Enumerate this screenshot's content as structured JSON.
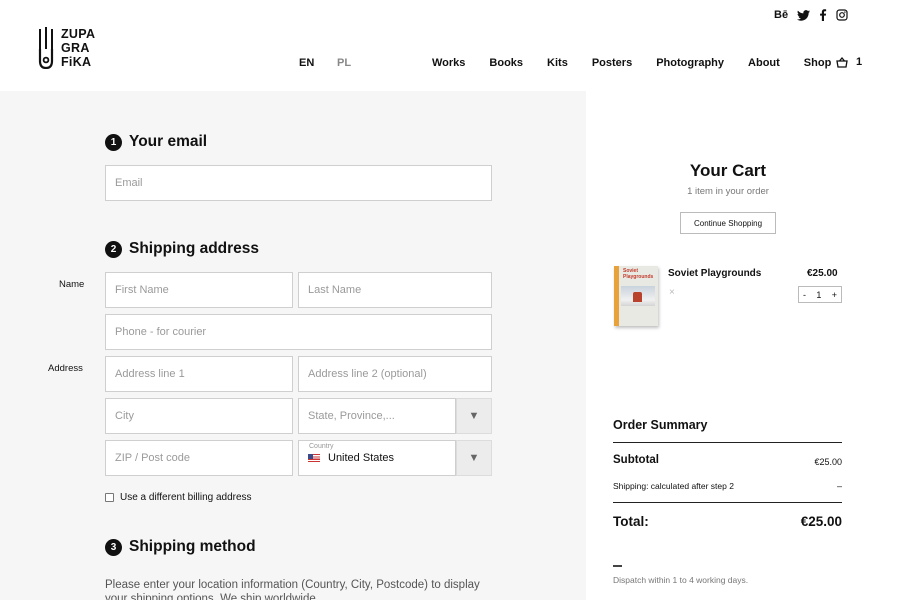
{
  "brand": {
    "line1": "ZUPA",
    "line2": "GRA",
    "line3": "FiKA"
  },
  "languages": {
    "en": "EN",
    "pl": "PL"
  },
  "nav": [
    "Works",
    "Books",
    "Kits",
    "Posters",
    "Photography",
    "About",
    "Shop"
  ],
  "cart_count": "1",
  "social": {
    "behance": "Bē",
    "icons": [
      "twitter-icon",
      "facebook-icon",
      "instagram-icon"
    ]
  },
  "steps": [
    {
      "num": "1",
      "title": "Your email"
    },
    {
      "num": "2",
      "title": "Shipping address"
    },
    {
      "num": "3",
      "title": "Shipping method"
    }
  ],
  "labels": {
    "name": "Name",
    "address": "Address"
  },
  "fields": {
    "email": "Email",
    "first_name": "First Name",
    "last_name": "Last Name",
    "phone": "Phone - for courier",
    "address1": "Address line 1",
    "address2": "Address line 2 (optional)",
    "city": "City",
    "state": "State, Province,...",
    "zip": "ZIP / Post code",
    "country_label": "Country",
    "country_value": "United States"
  },
  "billing_checkbox": "Use a different billing address",
  "shipping_note": "Please enter your location information (Country, City, Postcode) to display your shipping options. We ship worldwide.",
  "cart": {
    "title": "Your Cart",
    "subtitle": "1 item in your order",
    "continue": "Continue Shopping",
    "item": {
      "name": "Soviet Playgrounds",
      "price": "€25.00",
      "qty": "1",
      "cover_title": "Soviet Playgrounds"
    },
    "remove": "×",
    "minus": "-",
    "plus": "+"
  },
  "summary": {
    "title": "Order Summary",
    "subtotal_label": "Subtotal",
    "subtotal_value": "€25.00",
    "shipping_label": "Shipping: calculated after step 2",
    "shipping_value": "–",
    "total_label": "Total:",
    "total_value": "€25.00",
    "dispatch": "Dispatch within 1 to 4 working days."
  },
  "colors": {
    "form_bg": "#f6f6f6",
    "accent": "#111111"
  }
}
